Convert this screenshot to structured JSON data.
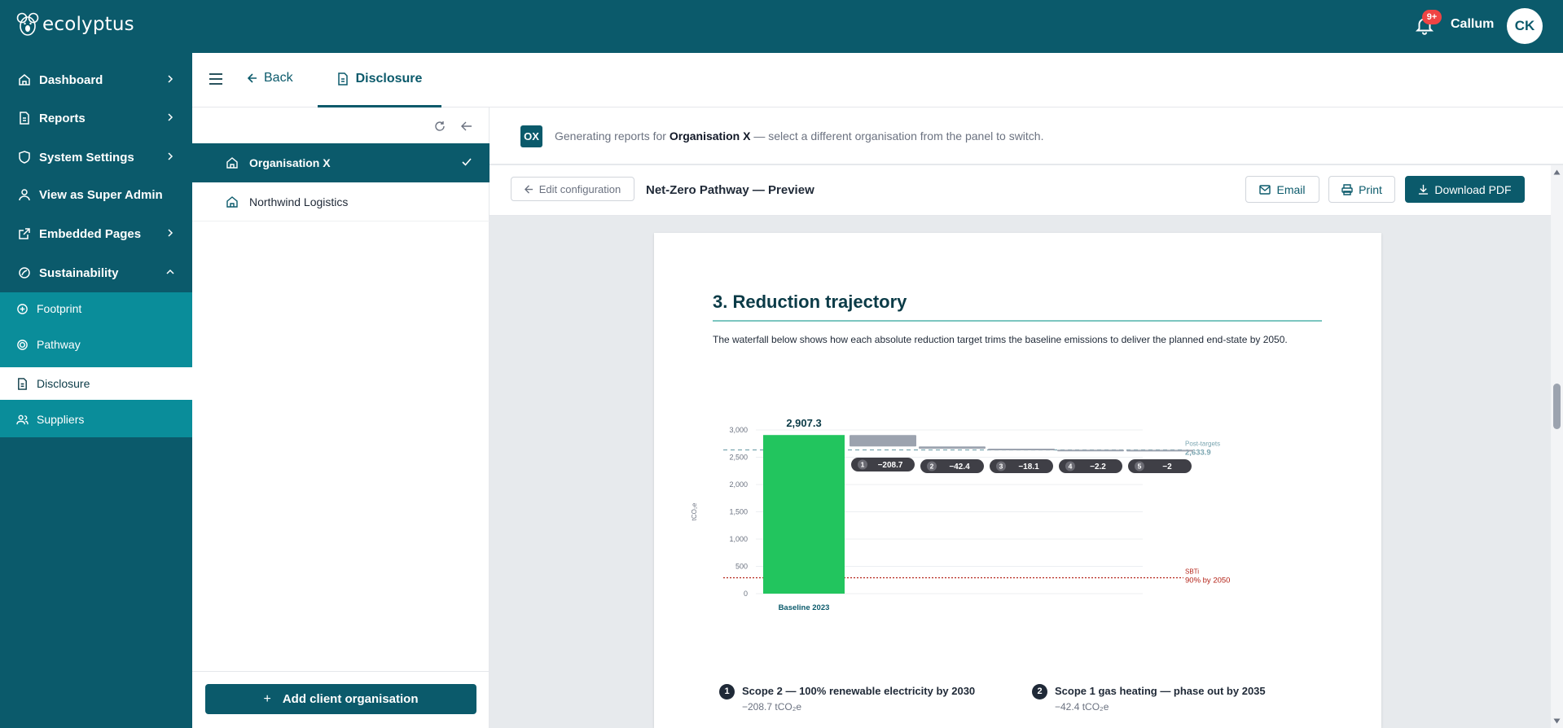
{
  "app": {
    "logo_text": "ecolyptus"
  },
  "header": {
    "notification_count": "9+",
    "user_name": "Callum",
    "user_initials": "CK"
  },
  "sidebar": {
    "items": [
      {
        "label": "Dashboard",
        "icon": "home-icon"
      },
      {
        "label": "Reports",
        "icon": "file-icon"
      },
      {
        "label": "System Settings",
        "icon": "shield-icon"
      },
      {
        "label": "View as Super Admin",
        "icon": "user-icon"
      },
      {
        "label": "Embedded Pages",
        "icon": "external-link-icon"
      },
      {
        "label": "Sustainability",
        "icon": "leaf-icon"
      }
    ],
    "sub_items": [
      {
        "label": "Footprint",
        "icon": "plus-circle-icon"
      },
      {
        "label": "Pathway",
        "icon": "target-icon"
      },
      {
        "label": "Disclosure",
        "icon": "file-icon"
      },
      {
        "label": "Suppliers",
        "icon": "users-icon"
      }
    ]
  },
  "tabs": {
    "back_label": "Back",
    "active_label": "Disclosure"
  },
  "org_panel": {
    "organisations": [
      "Organisation X",
      "Northwind Logistics"
    ],
    "add_button_label": "Add client organisation"
  },
  "notice": {
    "badge": "OX",
    "prefix": "Generating reports for ",
    "org": "Organisation X",
    "suffix": " — select a different organisation from the panel to switch."
  },
  "toolbar": {
    "edit_label": "Edit configuration",
    "title": "Net-Zero Pathway — Preview",
    "email_label": "Email",
    "print_label": "Print",
    "download_label": "Download PDF"
  },
  "report": {
    "section_title": "3. Reduction trajectory",
    "paragraph": "The waterfall below shows how each absolute reduction target trims the baseline emissions to deliver the planned end-state by 2050."
  },
  "chart_data": {
    "type": "bar",
    "subtype": "waterfall",
    "ylabel": "tCO₂e",
    "ylim": [
      0,
      3000
    ],
    "yticks": [
      0,
      500,
      1000,
      1500,
      2000,
      2500,
      3000
    ],
    "yticks_labels": [
      "0",
      "500",
      "1,000",
      "1,500",
      "2,000",
      "2,500",
      "3,000"
    ],
    "baseline": {
      "label": "Baseline 2023",
      "value": 2907.3,
      "value_label": "2,907.3"
    },
    "steps": [
      {
        "index": "1",
        "value": -208.7,
        "label": "−208.7"
      },
      {
        "index": "2",
        "value": -42.4,
        "label": "−42.4"
      },
      {
        "index": "3",
        "value": -18.1,
        "label": "−18.1"
      },
      {
        "index": "4",
        "value": -2.2,
        "label": "−2.2"
      },
      {
        "index": "5",
        "value": -2,
        "label": "−2"
      }
    ],
    "reference_lines": [
      {
        "name": "Post-targets",
        "label_line1": "Post-targets",
        "label_line2": "2,633.9",
        "value": 2633.9,
        "style": "dashed",
        "color": "#7aa5b0"
      },
      {
        "name": "SBTi",
        "label_line1": "SBTi",
        "label_line2": "90% by 2050",
        "value": 290.7,
        "style": "dotted",
        "color": "#b42318"
      }
    ],
    "colors": {
      "baseline": "#22c55e",
      "steps": "#9ca3af",
      "pill": "#3f3f46",
      "grid": "#eceff2"
    },
    "grid": true
  },
  "targets": [
    {
      "index": "1",
      "label": "Scope 2 — 100% renewable electricity by 2030",
      "sub": "−208.7 tCO₂e"
    },
    {
      "index": "2",
      "label": "Scope 1 gas heating — phase out by 2035",
      "sub": "−42.4 tCO₂e"
    }
  ]
}
